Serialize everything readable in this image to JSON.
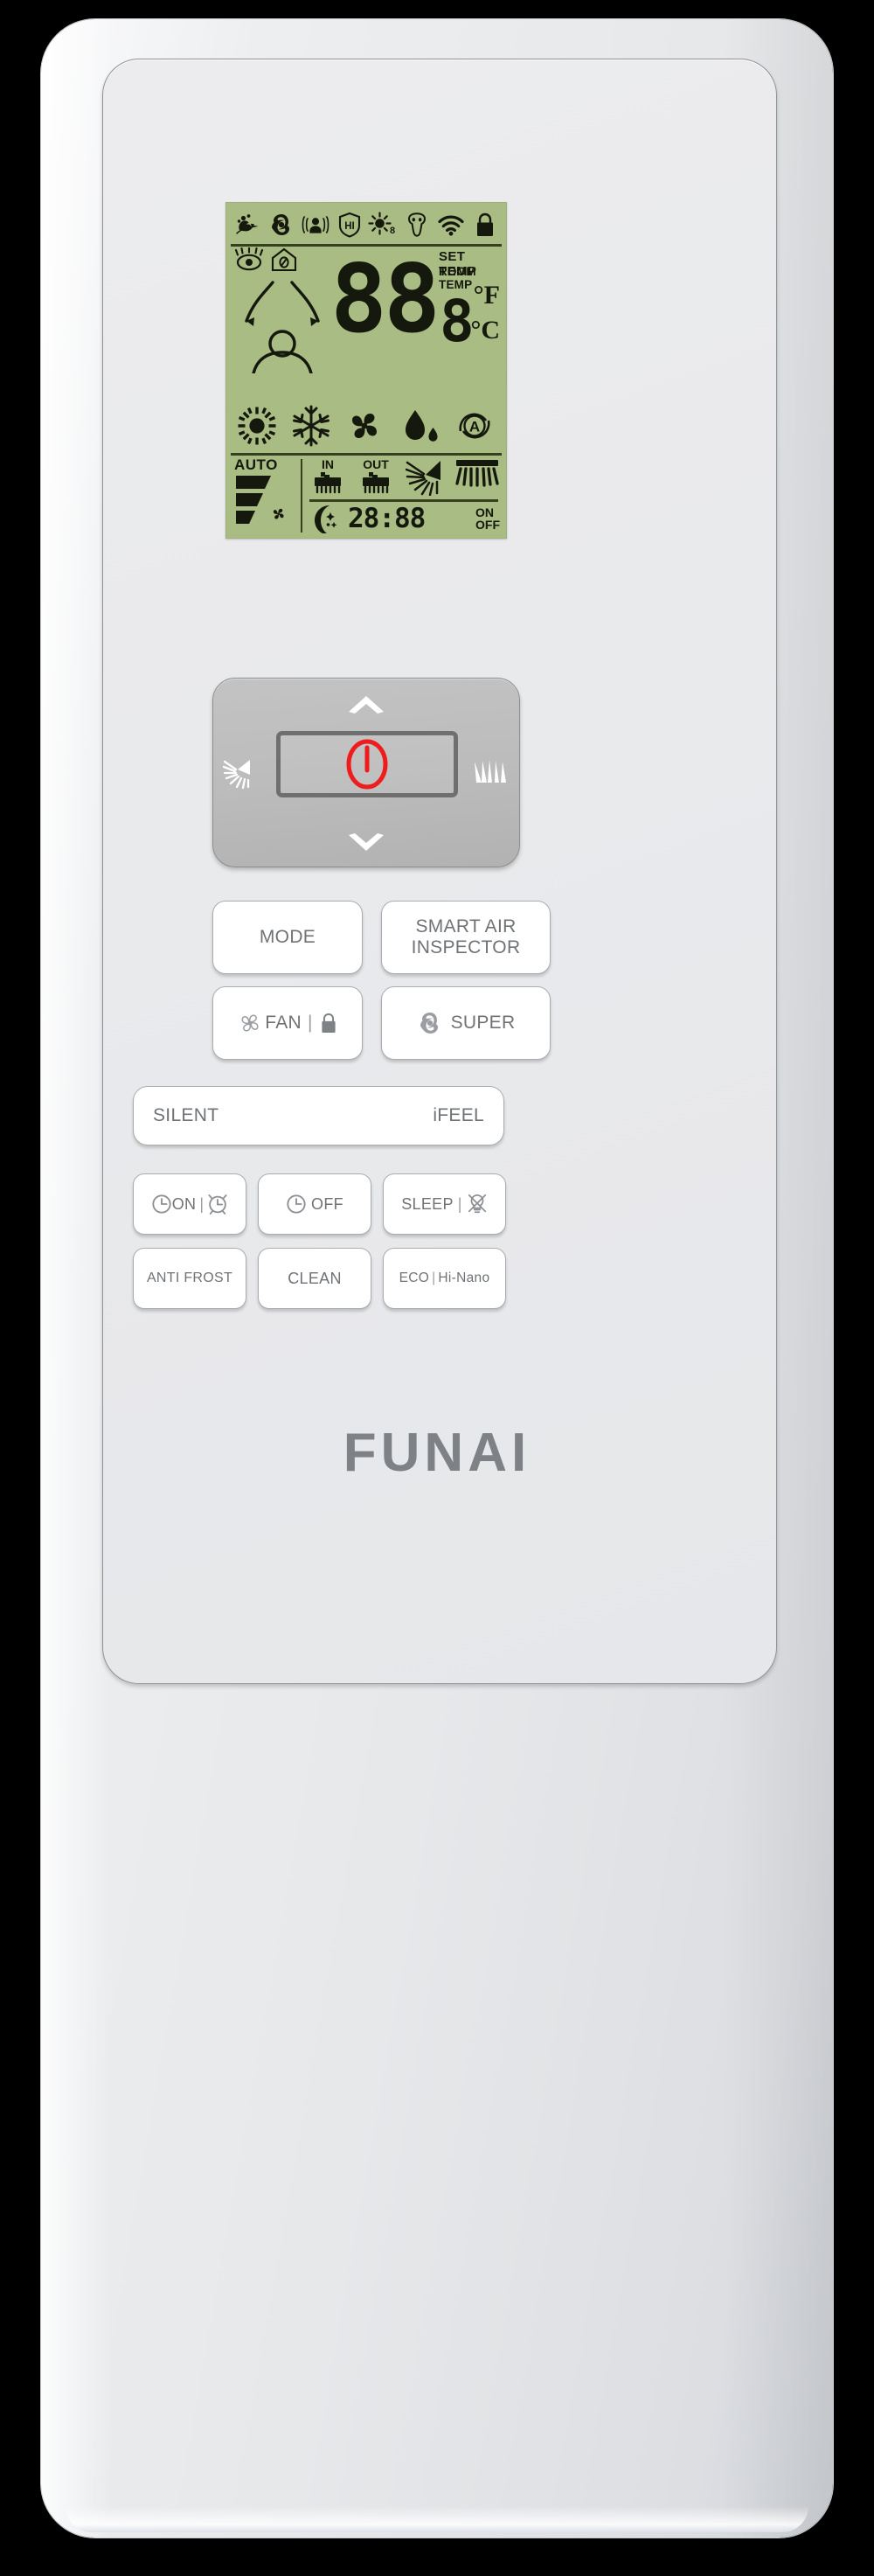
{
  "device": {
    "brand": "FUNAI",
    "type": "air-conditioner-remote-control"
  },
  "display": {
    "status_icons": [
      {
        "name": "eco-leaf-icon",
        "label": "ECO"
      },
      {
        "name": "turbo-swirl-icon",
        "label": "SUPER"
      },
      {
        "name": "ifeel-person-icon",
        "label": "iFEEL"
      },
      {
        "name": "hi-shield-icon",
        "label": "HI"
      },
      {
        "name": "sun-eight-icon",
        "label": "8°C HEAT"
      },
      {
        "name": "air-filter-mask-icon",
        "label": "FILTER"
      },
      {
        "name": "wifi-icon",
        "label": "WIFI"
      },
      {
        "name": "lock-icon",
        "label": "LOCK"
      }
    ],
    "indicator_icons": [
      {
        "name": "eye-watch-icon",
        "label": "EYE"
      },
      {
        "name": "home-icon",
        "label": "HOME"
      },
      {
        "name": "airflow-person-icon",
        "label": "AIRFLOW"
      }
    ],
    "temperature": {
      "digits": "88",
      "decimal_separator": ".",
      "decimal_digit": "8",
      "set_temp_label": "SET TEMP",
      "room_temp_label": "ROOM TEMP",
      "fahrenheit_label": "°F",
      "celsius_label": "°C"
    },
    "mode_icons": [
      {
        "name": "sun-heat-icon",
        "label": "HEAT"
      },
      {
        "name": "snowflake-cool-icon",
        "label": "COOL"
      },
      {
        "name": "fan-icon",
        "label": "FAN"
      },
      {
        "name": "water-drop-dry-icon",
        "label": "DRY"
      },
      {
        "name": "auto-circle-a-icon",
        "label": "AUTO"
      }
    ],
    "fan_speed": {
      "auto_label": "AUTO",
      "bars": 3,
      "fan_icon": "fan-small-icon"
    },
    "vent_icons": [
      {
        "name": "in-brush-icon",
        "label": "IN"
      },
      {
        "name": "out-brush-icon",
        "label": "OUT"
      },
      {
        "name": "vertical-swing-icon",
        "label": "VERTICAL SWING"
      },
      {
        "name": "horizontal-swing-icon",
        "label": "HORIZONTAL SWING"
      }
    ],
    "timer": {
      "moon_icon": "moon-sleep-icon",
      "value": "28:88",
      "on_label": "ON",
      "off_label": "OFF"
    },
    "lcd_color": "#a9bc83",
    "lcd_ink_color": "#15180c"
  },
  "power_pad": {
    "up_icon": "chevron-up-icon",
    "down_icon": "chevron-down-icon",
    "left_icon": "vertical-swing-icon",
    "right_icon": "horizontal-swing-icon",
    "power_icon": "power-icon",
    "power_color": "#ee1c1c",
    "pad_color": "#bcbcbc"
  },
  "buttons": {
    "mode": "MODE",
    "smart_air_line1": "SMART AIR",
    "smart_air_line2": "INSPECTOR",
    "fan": "FAN",
    "fan_icon": "fan-icon",
    "fan_lock_icon": "lock-icon",
    "fan_separator": "|",
    "super": "SUPER",
    "super_icon": "turbo-swirl-icon",
    "silent": "SILENT",
    "ifeel": "iFEEL",
    "timer_on": "ON",
    "timer_on_icon": "clock-icon",
    "timer_on_alarm_icon": "alarm-clock-icon",
    "timer_on_separator": "|",
    "timer_off": "OFF",
    "timer_off_icon": "clock-icon",
    "sleep": "SLEEP",
    "sleep_separator": "|",
    "sleep_icon": "lamp-off-icon",
    "anti_frost": "ANTI FROST",
    "clean": "CLEAN",
    "eco": "ECO",
    "eco_separator": "|",
    "hi_nano": "Hi-Nano"
  }
}
